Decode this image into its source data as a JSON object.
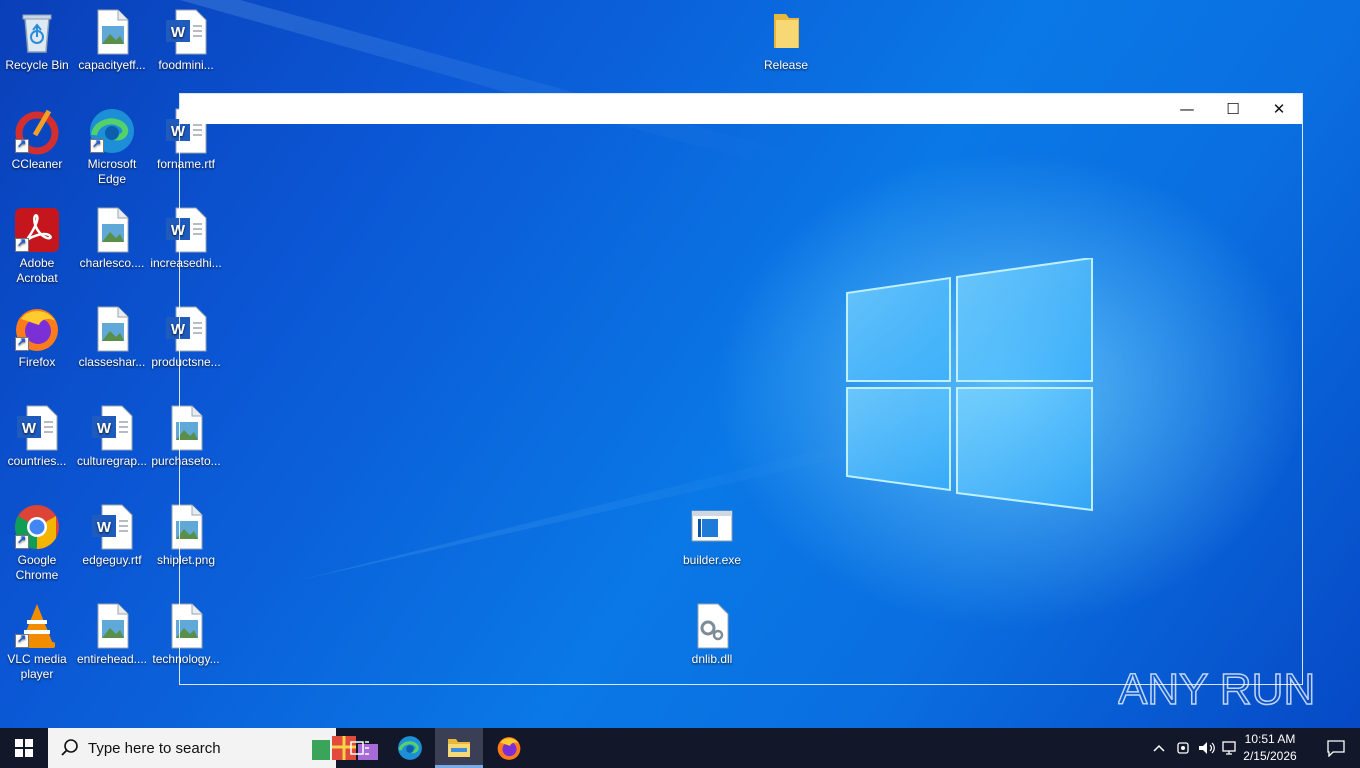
{
  "desktop": {
    "icons": [
      {
        "label": "Recycle Bin",
        "icon": "recycle-bin-icon"
      },
      {
        "label": "capacityeff...",
        "icon": "image-file-icon"
      },
      {
        "label": "foodmini...",
        "icon": "word-doc-icon"
      },
      {
        "label": "Release",
        "icon": "folder-icon"
      },
      {
        "label": "CCleaner",
        "icon": "ccleaner-icon"
      },
      {
        "label": "Microsoft Edge",
        "icon": "edge-icon"
      },
      {
        "label": "forname.rtf",
        "icon": "word-doc-icon"
      },
      {
        "label": "Adobe Acrobat",
        "icon": "acrobat-icon"
      },
      {
        "label": "charlesco....",
        "icon": "image-file-icon"
      },
      {
        "label": "increasedhi...",
        "icon": "word-doc-icon"
      },
      {
        "label": "Firefox",
        "icon": "firefox-icon"
      },
      {
        "label": "classeshar...",
        "icon": "image-file-icon"
      },
      {
        "label": "productsne...",
        "icon": "word-doc-icon"
      },
      {
        "label": "countries...",
        "icon": "word-doc-icon"
      },
      {
        "label": "culturegrap...",
        "icon": "word-doc-icon"
      },
      {
        "label": "purchaseto...",
        "icon": "image-file-icon"
      },
      {
        "label": "Google Chrome",
        "icon": "chrome-icon"
      },
      {
        "label": "edgeguy.rtf",
        "icon": "word-doc-icon"
      },
      {
        "label": "shiplet.png",
        "icon": "image-file-icon"
      },
      {
        "label": "VLC media player",
        "icon": "vlc-icon"
      },
      {
        "label": "entirehead....",
        "icon": "image-file-icon"
      },
      {
        "label": "technology...",
        "icon": "image-file-icon"
      },
      {
        "label": "builder.exe",
        "icon": "exe-icon"
      },
      {
        "label": "dnlib.dll",
        "icon": "dll-icon"
      }
    ]
  },
  "window": {
    "minimize_symbol": "—",
    "maximize_symbol": "☐",
    "close_symbol": "✕"
  },
  "watermark": {
    "text": "ANY RUN"
  },
  "taskbar": {
    "search_placeholder": "Type here to search",
    "clock_time": "10:51 AM",
    "clock_date": "2/15/2026",
    "tray_chevron": "^"
  },
  "colors": {
    "taskbar_bg": "#13172a",
    "desktop_accent": "#0a78e6"
  }
}
